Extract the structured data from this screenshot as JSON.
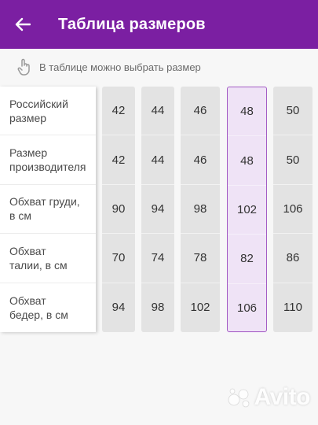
{
  "appbar": {
    "title": "Таблица размеров",
    "back_icon": "arrow-left-icon",
    "color": "#7b1fa2"
  },
  "hint": {
    "icon": "tap-hand-icon",
    "text": "В таблице можно выбрать размер"
  },
  "table": {
    "row_labels": [
      "Российский\nразмер",
      "Размер\nпроизводителя",
      "Обхват груди,\nв см",
      "Обхват\nталии, в см",
      "Обхват\nбедер, в см"
    ],
    "columns": [
      {
        "values": [
          "42",
          "42",
          "90",
          "70",
          "94"
        ],
        "selected": false
      },
      {
        "values": [
          "44",
          "44",
          "94",
          "74",
          "98"
        ],
        "selected": false
      },
      {
        "values": [
          "46",
          "46",
          "98",
          "78",
          "102"
        ],
        "selected": false
      },
      {
        "values": [
          "48",
          "48",
          "102",
          "82",
          "106"
        ],
        "selected": true
      },
      {
        "values": [
          "50",
          "50",
          "106",
          "86",
          "110"
        ],
        "selected": false
      }
    ],
    "selected_color": "#a35bc4"
  },
  "watermark": {
    "text": "Avito"
  }
}
